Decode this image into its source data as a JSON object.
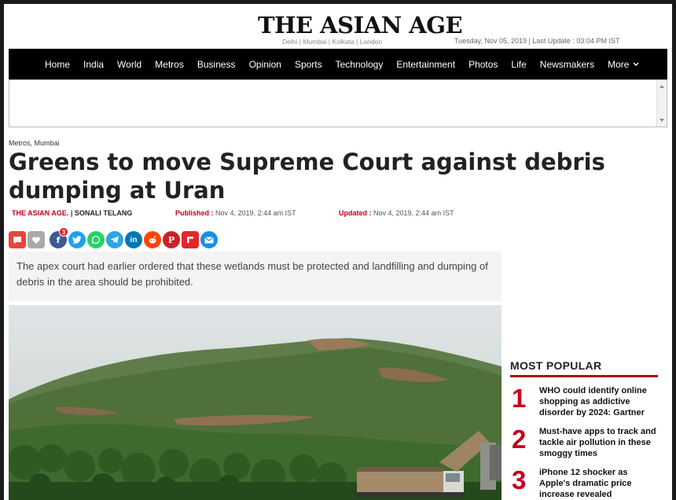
{
  "header": {
    "logo": "THE ASIAN AGE",
    "editions": "Delhi | Mumbai | Kolkata | London",
    "dateline": "Tuesday, Nov 05, 2019 | Last Update : 03:04 PM IST"
  },
  "nav": {
    "items": [
      "Home",
      "India",
      "World",
      "Metros",
      "Business",
      "Opinion",
      "Sports",
      "Technology",
      "Entertainment",
      "Photos",
      "Life",
      "Newsmakers"
    ],
    "more": "More"
  },
  "article": {
    "breadcrumb": "Metros, Mumbai",
    "headline": "Greens to move Supreme Court against debris dumping at Uran",
    "source": "THE ASIAN AGE.",
    "separator": "|",
    "author": "SONALI TELANG",
    "published_label": "Published :",
    "published_value": "Nov 4, 2019, 2:44 am IST",
    "updated_label": "Updated :",
    "updated_value": "Nov 4, 2019, 2:44 am IST",
    "summary": "The apex court had earlier ordered that these wetlands must be protected and landfilling and dumping of debris in the area should be prohibited."
  },
  "share": {
    "facebook_count": "3",
    "colors": {
      "comment": "#e8453c",
      "like": "#aaaaaa",
      "facebook": "#3b5998",
      "twitter": "#1da1f2",
      "whatsapp": "#25d366",
      "telegram": "#2ca5e0",
      "linkedin": "#0077b5",
      "reddit": "#ff4500",
      "pinterest": "#cb2027",
      "flipboard": "#e12828",
      "email": "#1a8fe3"
    }
  },
  "popular": {
    "title": "MOST POPULAR",
    "items": [
      {
        "num": "1",
        "text": "WHO could identify online shopping as addictive disorder by 2024: Gartner"
      },
      {
        "num": "2",
        "text": "Must-have apps to track and tackle air pollution in these smoggy times"
      },
      {
        "num": "3",
        "text": "iPhone 12 shocker as Apple's dramatic price increase revealed"
      }
    ]
  },
  "theme": {
    "accent": "#c0001a",
    "nav_bg": "#000000"
  }
}
